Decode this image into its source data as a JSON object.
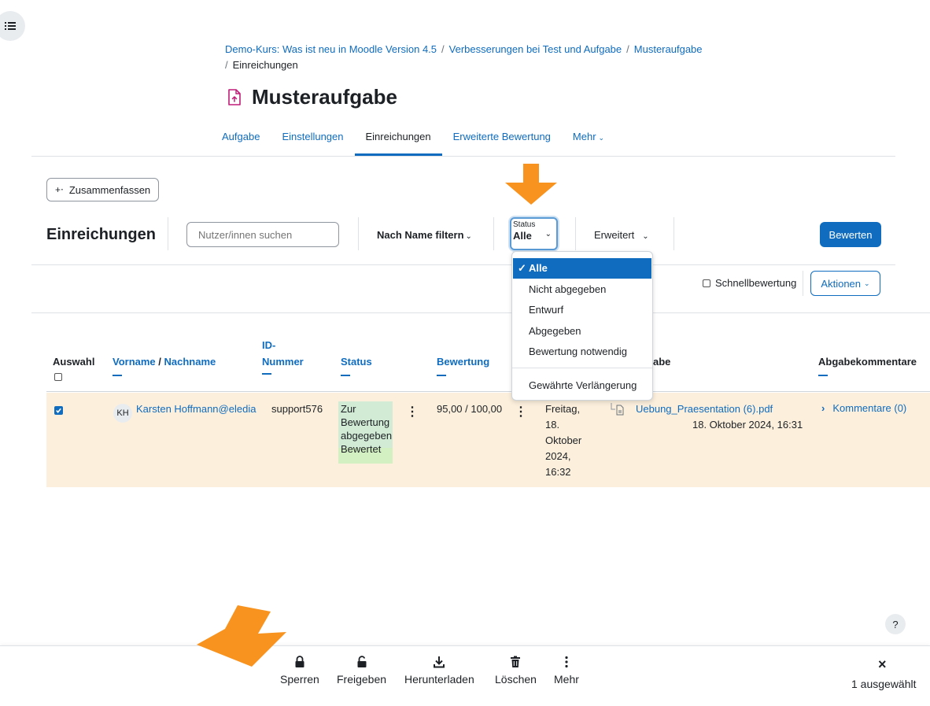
{
  "breadcrumb": {
    "items": [
      "Demo-Kurs: Was ist neu in Moodle Version 4.5",
      "Verbesserungen bei Test und Aufgabe",
      "Musteraufgabe"
    ],
    "current": "Einreichungen",
    "separator": "/"
  },
  "page": {
    "title": "Musteraufgabe"
  },
  "tabs": [
    {
      "label": "Aufgabe"
    },
    {
      "label": "Einstellungen"
    },
    {
      "label": "Einreichungen"
    },
    {
      "label": "Erweiterte Bewertung"
    },
    {
      "label": "Mehr"
    }
  ],
  "summary_button": "Zusammenfassen",
  "toolbar": {
    "title": "Einreichungen",
    "search_placeholder": "Nutzer/innen suchen",
    "name_filter": "Nach Name filtern",
    "status_label": "Status",
    "status_value": "Alle",
    "advanced": "Erweitert",
    "grade_button": "Bewerten"
  },
  "quickgrade": "Schnellbewertung",
  "actions_button": "Aktionen",
  "status_dropdown": {
    "options": [
      "Alle",
      "Nicht abgegeben",
      "Entwurf",
      "Abgegeben",
      "Bewertung notwendig"
    ],
    "extra_option": "Gewährte Verlängerung"
  },
  "table": {
    "headers": {
      "select": "Auswahl",
      "firstname": "Vorname",
      "name_sep": " / ",
      "lastname": "Nachname",
      "id_line1": "ID-",
      "id_line2": "Nummer",
      "status": "Status",
      "grade": "Bewertung",
      "file_partial": "abe",
      "comments": "Abgabekommentare"
    },
    "row": {
      "initials": "KH",
      "name": "Karsten Hoffmann@eledia",
      "id": "support576",
      "status_lines": [
        "Zur",
        "Bewertung",
        "abgegeben"
      ],
      "status_graded": "Bewertet",
      "grade": "95,00 / 100,00",
      "modified_lines": [
        "Freitag,",
        "18.",
        "Oktober",
        "2024,",
        "16:32"
      ],
      "file_name": "Uebung_Praesentation (6).pdf",
      "file_date": "18. Oktober 2024, 16:31",
      "comments": "Kommentare (0)"
    }
  },
  "help": "?",
  "bulk_actions": {
    "items": [
      {
        "label": "Sperren",
        "icon": "lock-icon"
      },
      {
        "label": "Freigeben",
        "icon": "unlock-icon"
      },
      {
        "label": "Herunterladen",
        "icon": "download-icon"
      },
      {
        "label": "Löschen",
        "icon": "trash-icon"
      },
      {
        "label": "Mehr",
        "icon": "more-vertical-icon"
      }
    ],
    "close": "×",
    "selected_count": "1 ausgewählt"
  },
  "colors": {
    "primary": "#0f6cbf",
    "highlight_arrow": "#f7931e",
    "row_selected": "#fcefdc",
    "status_submitted": "#d2ebd5",
    "status_graded": "#d2f0c2",
    "assign_icon": "#c01c78"
  }
}
